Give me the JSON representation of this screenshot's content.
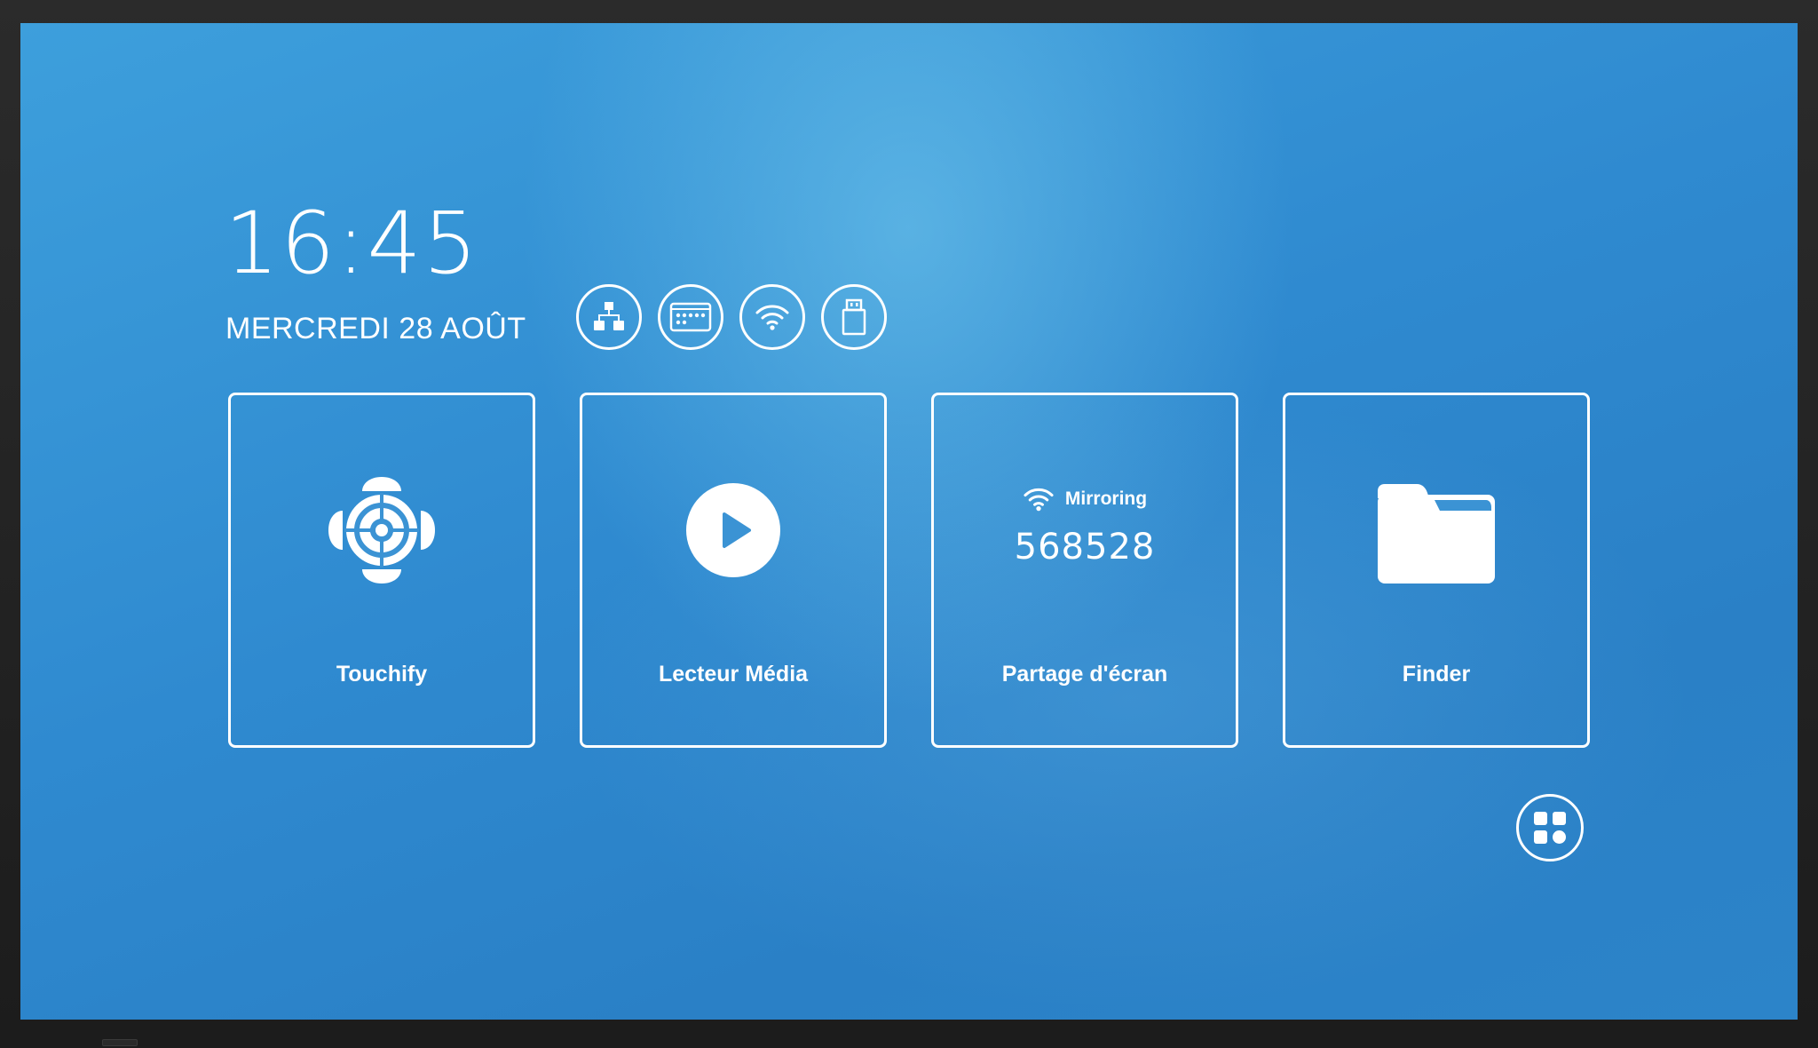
{
  "home": {
    "time": "16:45",
    "date": "MERCREDI 28 AOÛT"
  },
  "status_icons": [
    {
      "icon": "network-icon"
    },
    {
      "icon": "keyboard-icon"
    },
    {
      "icon": "wifi-icon"
    },
    {
      "icon": "usb-icon"
    }
  ],
  "tiles": [
    {
      "label": "Touchify",
      "icon": "touchify-icon"
    },
    {
      "label": "Lecteur Média",
      "icon": "play-icon"
    },
    {
      "label": "Partage d'écran",
      "icon": "wifi-icon",
      "mirroring_label": "Mirroring",
      "mirroring_code": "568528"
    },
    {
      "label": "Finder",
      "icon": "folder-icon"
    }
  ],
  "apps_button": {
    "icon": "apps-grid-icon"
  },
  "colors": {
    "background": "#2f8ad0",
    "foreground": "#ffffff",
    "bezel": "#1c1c1c"
  }
}
